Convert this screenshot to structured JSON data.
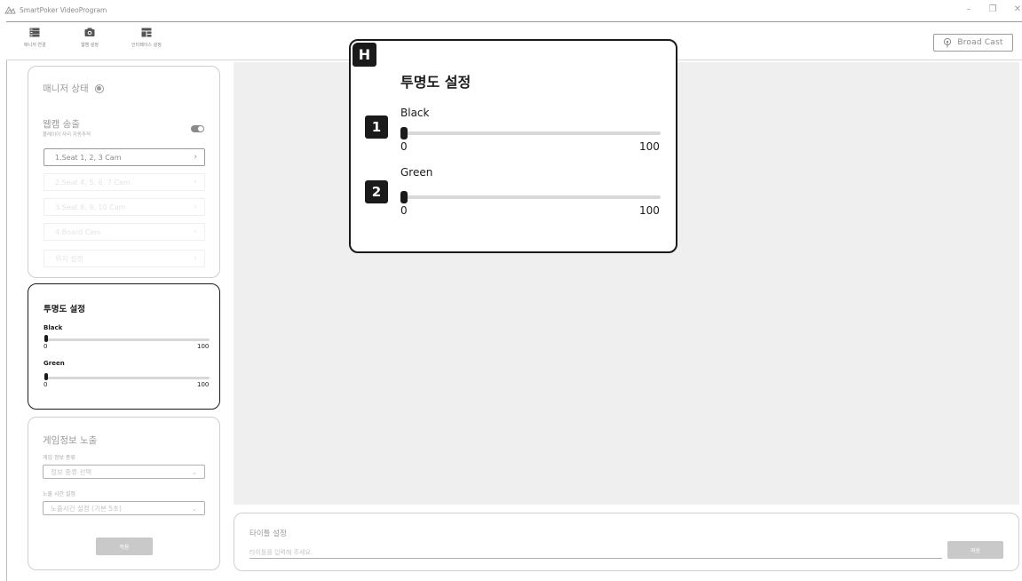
{
  "app": {
    "title": "SmartPoker VideoProgram"
  },
  "window_controls": {
    "minimize": "–",
    "restore": "❐",
    "close": "✕"
  },
  "top_menu": [
    {
      "label": "매니저 연결",
      "icon": "server-icon"
    },
    {
      "label": "웹캠 설정",
      "icon": "camera-icon"
    },
    {
      "label": "인터페이스 설정",
      "icon": "layout-icon"
    }
  ],
  "broadcast": {
    "label": "Broad Cast",
    "icon": "broadcast-icon"
  },
  "manager_panel": {
    "title": "매니저 상태",
    "webcam_title": "웹캠 송출",
    "webcam_subtitle": "플레이어 자리 자동추적",
    "toggle_on": true,
    "cam_rows": [
      {
        "label": "1.Seat 1, 2, 3 Cam",
        "enabled": true
      },
      {
        "label": "2.Seat 4, 5, 6, 7 Cam",
        "enabled": false
      },
      {
        "label": "3.Seat 8, 9, 10 Cam",
        "enabled": false
      },
      {
        "label": "4.Board Cam",
        "enabled": false
      },
      {
        "label": "위치 설정",
        "enabled": false
      }
    ],
    "chevron": "›"
  },
  "opacity_panel": {
    "title": "투명도 설정",
    "sliders": [
      {
        "label": "Black",
        "value": 0,
        "min": "0",
        "max": "100"
      },
      {
        "label": "Green",
        "value": 0,
        "min": "0",
        "max": "100"
      }
    ]
  },
  "game_panel": {
    "title": "게임정보 노출",
    "info_type_label": "게임 정보 종류",
    "info_type_placeholder": "정보 종류 선택",
    "time_label": "노출 시간 설정",
    "time_placeholder": "노출시간 설정 (기본 5초)",
    "apply_label": "적용",
    "chevron": "⌄"
  },
  "title_panel": {
    "label": "타이틀 설정",
    "placeholder": "타이틀를 입력해 주세요.",
    "apply_label": "적용"
  },
  "callout": {
    "badge": "H",
    "title": "투명도 설정",
    "sliders": [
      {
        "badge": "1",
        "label": "Black",
        "value": 0,
        "min": "0",
        "max": "100"
      },
      {
        "badge": "2",
        "label": "Green",
        "value": 0,
        "min": "0",
        "max": "100"
      }
    ]
  }
}
